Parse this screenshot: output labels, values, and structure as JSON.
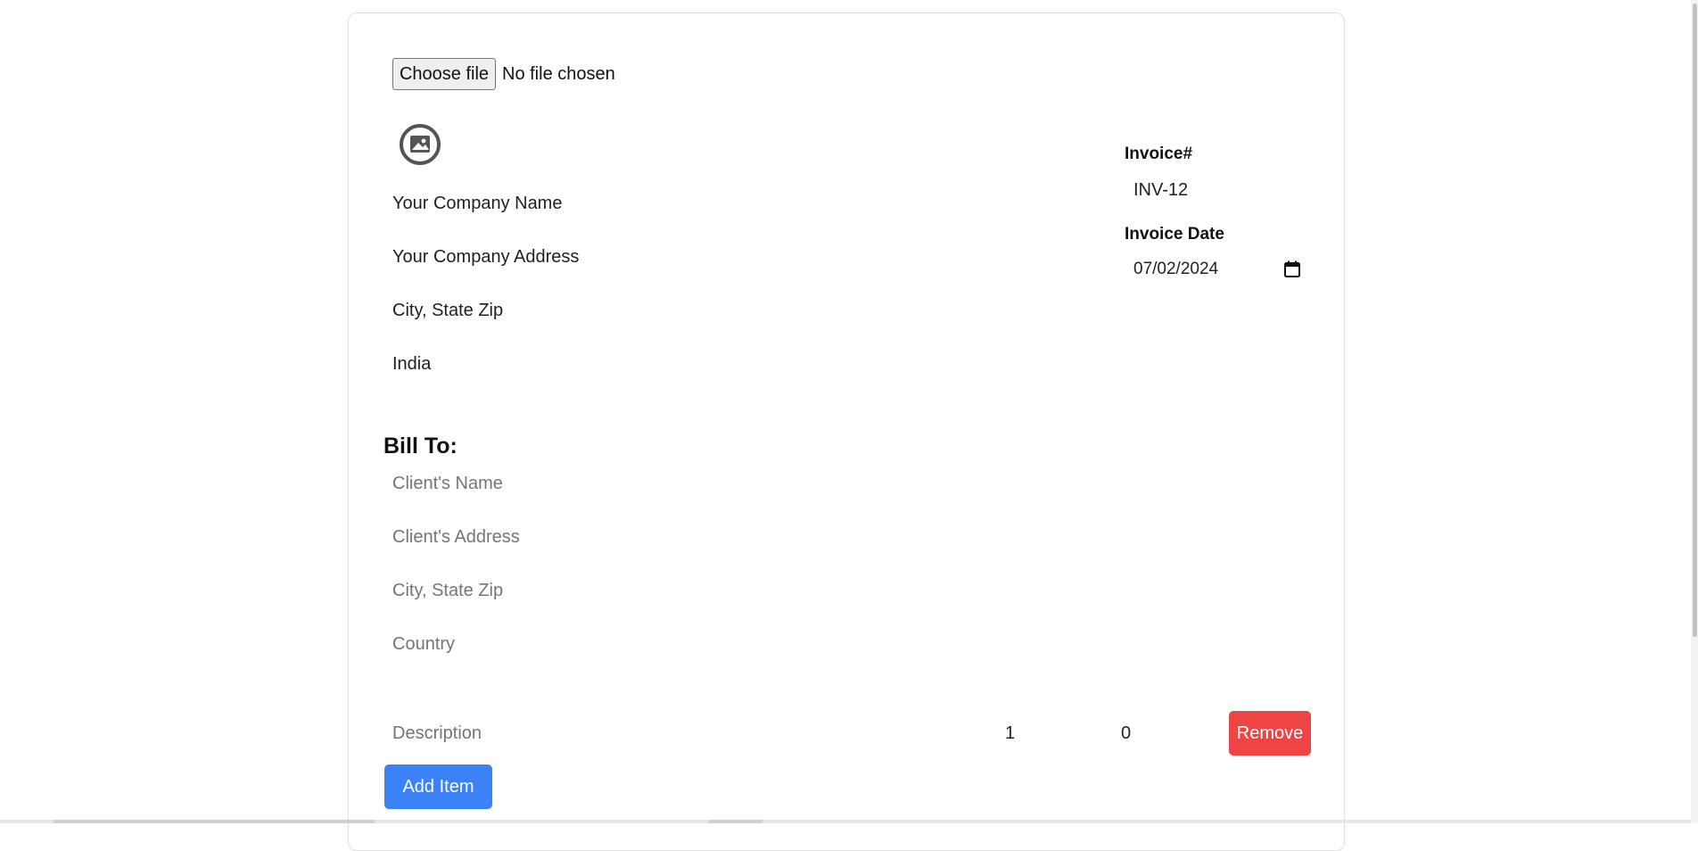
{
  "file_upload": {
    "button_label": "Choose file",
    "status_text": "No file chosen"
  },
  "company": {
    "name": "Your Company Name",
    "address": "Your Company Address",
    "city_state_zip": "City, State Zip",
    "country": "India"
  },
  "invoice": {
    "number_label": "Invoice#",
    "number_value": "INV-12",
    "date_label": "Invoice Date",
    "date_value": "07/02/2024"
  },
  "bill_to": {
    "heading": "Bill To:",
    "name_placeholder": "Client's Name",
    "address_placeholder": "Client's Address",
    "city_placeholder": "City, State Zip",
    "country_placeholder": "Country"
  },
  "items": [
    {
      "description_placeholder": "Description",
      "quantity": "1",
      "price": "0",
      "remove_label": "Remove"
    }
  ],
  "actions": {
    "add_item_label": "Add Item"
  },
  "colors": {
    "remove": "#ef4444",
    "add": "#3b82f6",
    "placeholder": "#9aa0a8"
  },
  "icons": {
    "logo_placeholder": "image-circle-icon",
    "calendar": "calendar-icon"
  }
}
